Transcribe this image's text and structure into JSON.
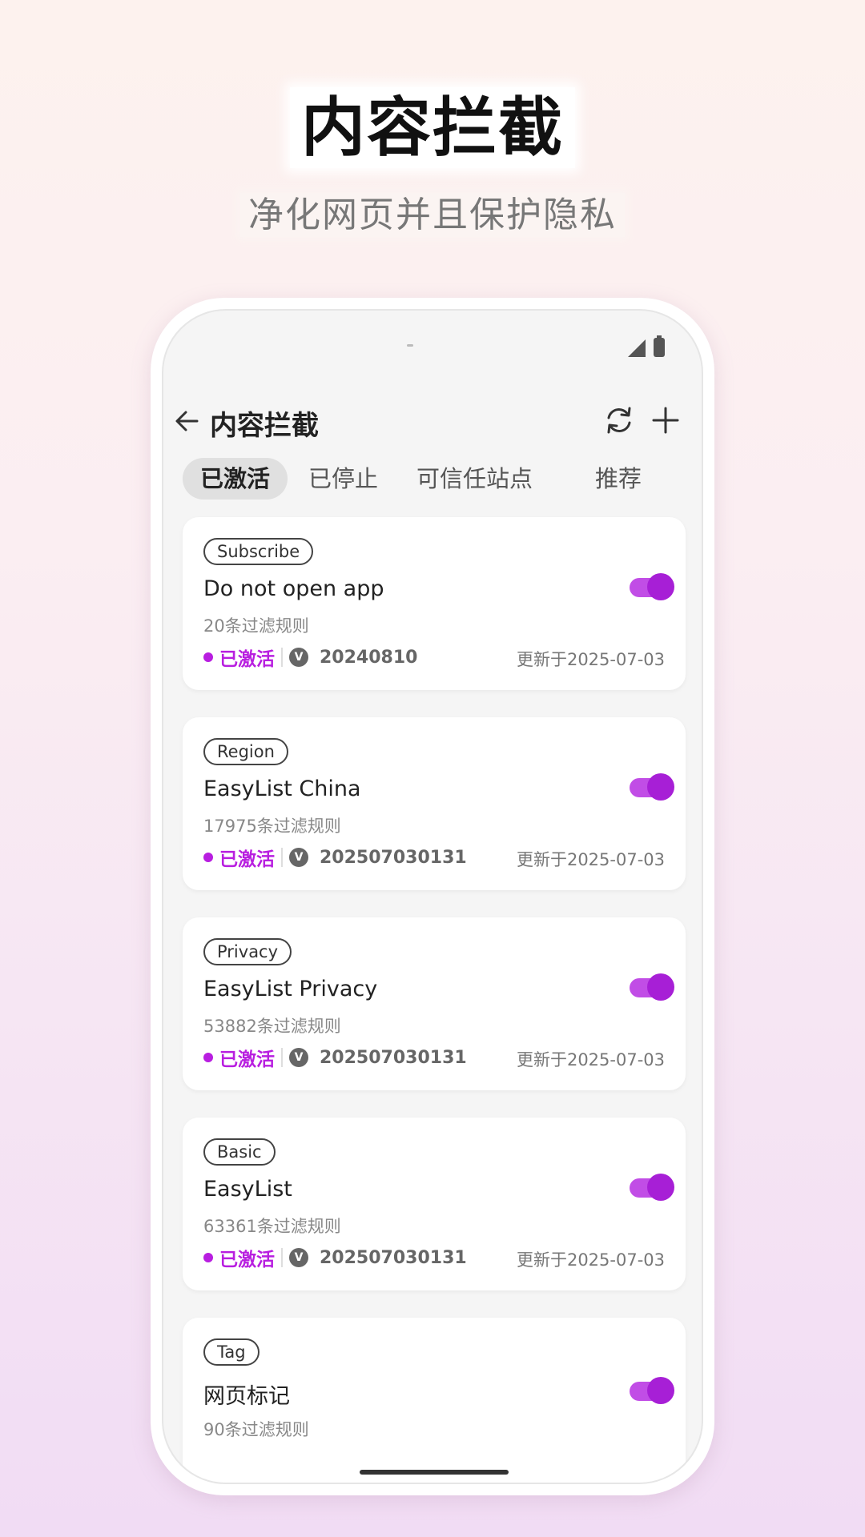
{
  "hero": {
    "title": "内容拦截",
    "subtitle": "净化网页并且保护隐私"
  },
  "appbar": {
    "title": "内容拦截",
    "icons": [
      "back-arrow-icon",
      "refresh-icon",
      "add-icon"
    ]
  },
  "tabs": [
    {
      "label": "已激活",
      "active": true
    },
    {
      "label": "已停止",
      "active": false
    },
    {
      "label": "可信任站点",
      "active": false
    },
    {
      "label": "推荐",
      "active": false
    }
  ],
  "cards": [
    {
      "tag": "Subscribe",
      "name": "Do not open app",
      "rules": "20条过滤规则",
      "status": "已激活",
      "version": "20240810",
      "updated": "更新于2025-07-03",
      "enabled": true
    },
    {
      "tag": "Region",
      "name": "EasyList China",
      "rules": "17975条过滤规则",
      "status": "已激活",
      "version": "202507030131",
      "updated": "更新于2025-07-03",
      "enabled": true
    },
    {
      "tag": "Privacy",
      "name": "EasyList Privacy",
      "rules": "53882条过滤规则",
      "status": "已激活",
      "version": "202507030131",
      "updated": "更新于2025-07-03",
      "enabled": true
    },
    {
      "tag": "Basic",
      "name": "EasyList",
      "rules": "63361条过滤规则",
      "status": "已激活",
      "version": "202507030131",
      "updated": "更新于2025-07-03",
      "enabled": true
    },
    {
      "tag": "Tag",
      "name": "网页标记",
      "rules": "90条过滤规则",
      "enabled": true
    }
  ],
  "v_badge": "V",
  "colors": {
    "accent": "#b81ee0",
    "toggle_track": "#c14de6",
    "toggle_thumb": "#a71fd6"
  }
}
